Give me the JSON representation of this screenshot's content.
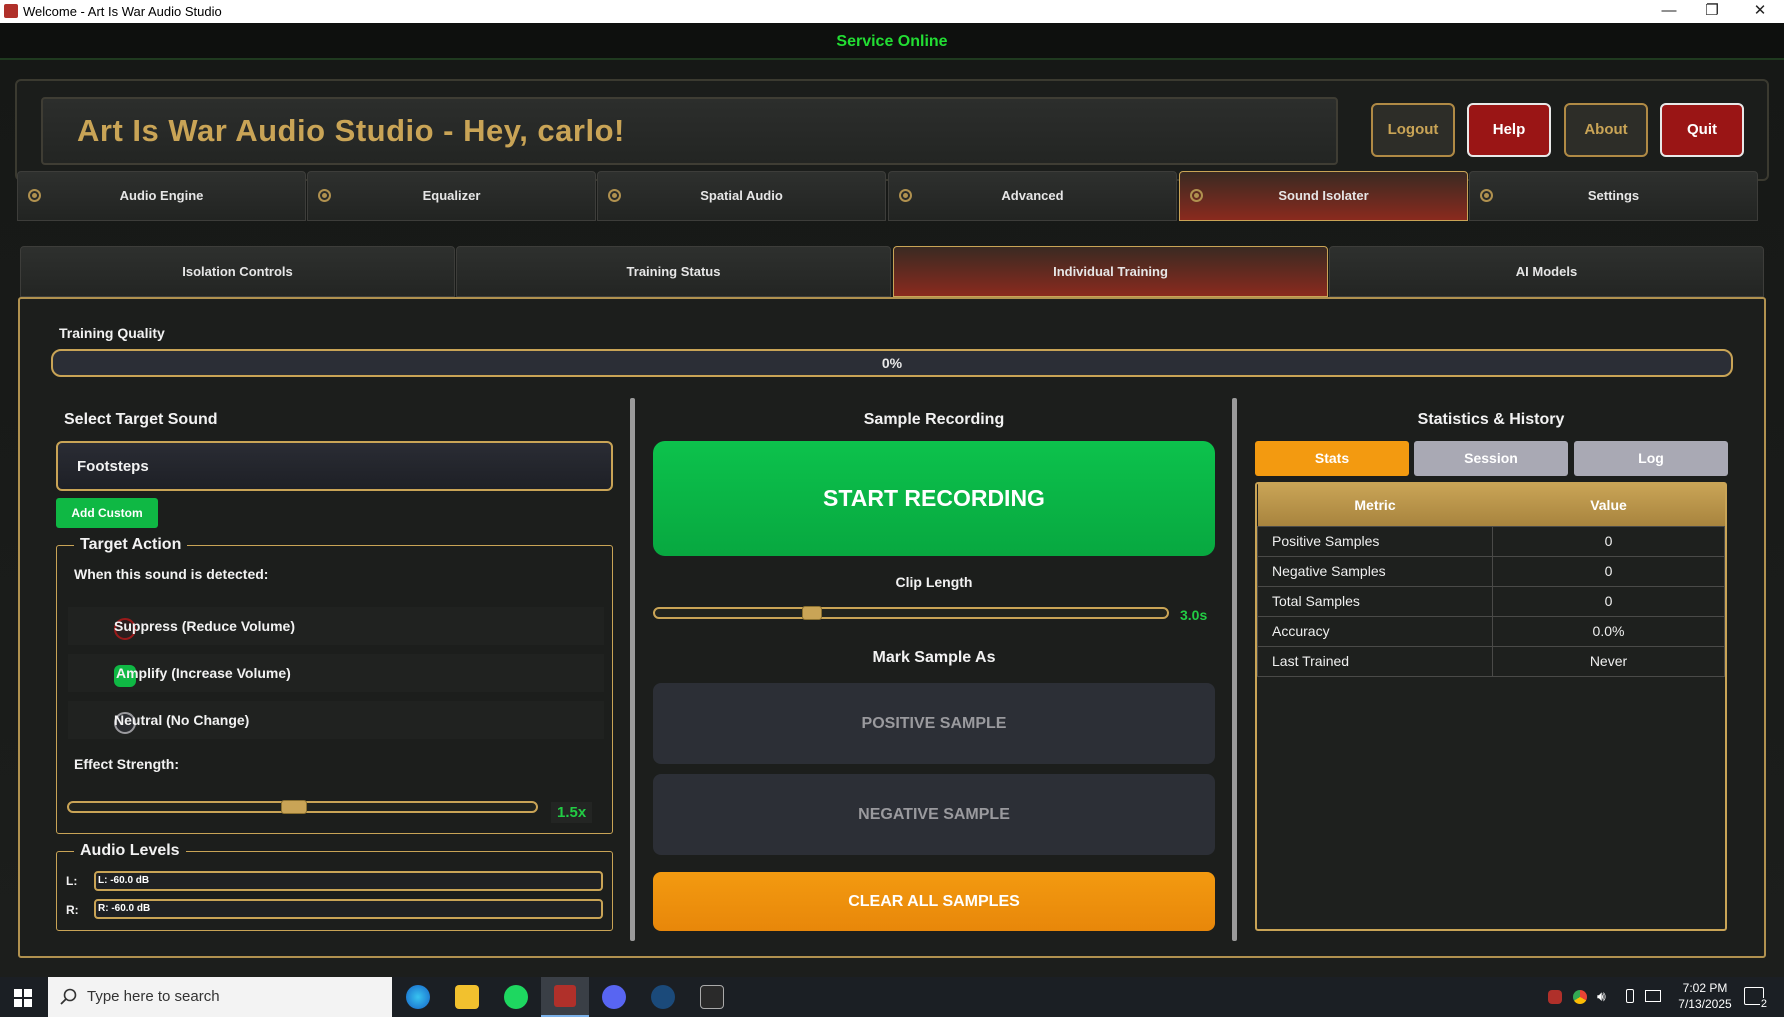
{
  "window": {
    "title": "Welcome - Art Is War Audio Studio",
    "minimize": "—",
    "restore": "❐",
    "close": "✕"
  },
  "status": "Service Online",
  "header": {
    "title": "Art Is War Audio Studio - Hey, carlo!",
    "buttons": {
      "logout": "Logout",
      "help": "Help",
      "about": "About",
      "quit": "Quit"
    }
  },
  "main_tabs": [
    "Audio Engine",
    "Equalizer",
    "Spatial Audio",
    "Advanced",
    "Sound Isolater",
    "Settings"
  ],
  "sub_tabs": [
    "Isolation Controls",
    "Training Status",
    "Individual Training",
    "AI Models"
  ],
  "training_quality": {
    "label": "Training Quality",
    "value": "0%",
    "fraction": 0
  },
  "left": {
    "select_label": "Select Target Sound",
    "selected_sound": "Footsteps",
    "add_custom": "Add Custom",
    "target_action": {
      "title": "Target Action",
      "prompt": "When this sound is detected:",
      "options": [
        "Suppress (Reduce Volume)",
        "Amplify (Increase Volume)",
        "Neutral (No Change)"
      ],
      "selected": "Amplify (Increase Volume)",
      "effect_label": "Effect Strength:",
      "effect_value": "1.5x",
      "effect_fraction": 0.48
    },
    "audio_levels": {
      "title": "Audio Levels",
      "left_label": "L:",
      "left_value": "L: -60.0 dB",
      "right_label": "R:",
      "right_value": "R: -60.0 dB"
    }
  },
  "middle": {
    "title": "Sample Recording",
    "start_button": "START RECORDING",
    "clip_label": "Clip Length",
    "clip_value": "3.0s",
    "clip_fraction": 0.3,
    "mark_label": "Mark Sample As",
    "positive": "POSITIVE SAMPLE",
    "negative": "NEGATIVE SAMPLE",
    "clear": "CLEAR ALL SAMPLES"
  },
  "right": {
    "title": "Statistics & History",
    "tabs": [
      "Stats",
      "Session",
      "Log"
    ],
    "headers": [
      "Metric",
      "Value"
    ],
    "rows": [
      [
        "Positive Samples",
        "0"
      ],
      [
        "Negative Samples",
        "0"
      ],
      [
        "Total Samples",
        "0"
      ],
      [
        "Accuracy",
        "0.0%"
      ],
      [
        "Last Trained",
        "Never"
      ]
    ]
  },
  "taskbar": {
    "search_placeholder": "Type here to search",
    "time": "7:02 PM",
    "date": "7/13/2025",
    "notifications": "2"
  },
  "colors": {
    "accent_gold": "#c9a456",
    "green": "#0cc24c",
    "red": "#9a1515",
    "orange": "#f39a10",
    "status_green": "#22dd33"
  }
}
